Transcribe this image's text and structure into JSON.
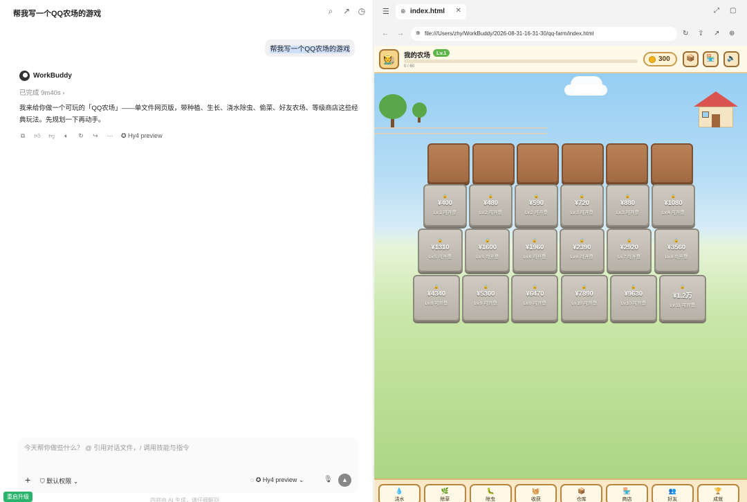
{
  "chat": {
    "title": "帮我写一个QQ农场的游戏",
    "user_message": "帮我写一个QQ农场的游戏",
    "bot_name": "WorkBuddy",
    "status": "已完成 9m40s ›",
    "bot_text": "我来给你做一个可玩的「QQ农场」——单文件网页版，带种植、生长、浇水除虫、偷菜、好友农场、等级商店这些经典玩法。先规划一下再动手。",
    "model_tag": "Hy4 preview",
    "composer_placeholder": "今天帮你做些什么？ @ 引用对话文件，/ 调用技能与指令",
    "permission_label": "默认权限 ⌄",
    "model_label": "Hy4 preview ⌄",
    "upgrade_label": "重启升级",
    "disclaimer": "内容由 AI 生成，请仔细甄别"
  },
  "browser": {
    "tab_title": "index.html",
    "url": "file:///Users/zhy/WorkBuddy/2026-08-31-16-31-30/qq-farm/index.html"
  },
  "game": {
    "farm_name": "我的农场",
    "level": "Lv.1",
    "xp_text": "0 / 60",
    "xp_progress": 0,
    "coins": "300",
    "tilled_count": 6,
    "locked_plots": [
      {
        "price": "¥400",
        "req": "Lv.1 可开垦"
      },
      {
        "price": "¥480",
        "req": "Lv.2 可开垦"
      },
      {
        "price": "¥590",
        "req": "Lv.2 可开垦"
      },
      {
        "price": "¥720",
        "req": "Lv.3 可开垦"
      },
      {
        "price": "¥880",
        "req": "Lv.3 可开垦"
      },
      {
        "price": "¥1080",
        "req": "Lv.4 可开垦"
      },
      {
        "price": "¥1310",
        "req": "Lv.5 可开垦"
      },
      {
        "price": "¥1600",
        "req": "Lv.5 可开垦"
      },
      {
        "price": "¥1960",
        "req": "Lv.6 可开垦"
      },
      {
        "price": "¥2390",
        "req": "Lv.6 可开垦"
      },
      {
        "price": "¥2920",
        "req": "Lv.7 可开垦"
      },
      {
        "price": "¥3560",
        "req": "Lv.8 可开垦"
      },
      {
        "price": "¥4340",
        "req": "Lv.8 可开垦"
      },
      {
        "price": "¥5300",
        "req": "Lv.9 可开垦"
      },
      {
        "price": "¥6470",
        "req": "Lv.9 可开垦"
      },
      {
        "price": "¥7890",
        "req": "Lv.10 可开垦"
      },
      {
        "price": "¥9630",
        "req": "Lv.10 可开垦"
      },
      {
        "price": "¥1.2万",
        "req": "Lv.11 可开垦"
      }
    ],
    "tools": [
      {
        "label": "浇水",
        "icon": "💧"
      },
      {
        "label": "除草",
        "icon": "🌿"
      },
      {
        "label": "除虫",
        "icon": "🐛"
      },
      {
        "label": "收获",
        "icon": "🧺"
      },
      {
        "label": "仓库",
        "icon": "📦"
      },
      {
        "label": "商店",
        "icon": "🏪"
      },
      {
        "label": "好友",
        "icon": "👥"
      },
      {
        "label": "成就",
        "icon": "🏆"
      }
    ]
  }
}
